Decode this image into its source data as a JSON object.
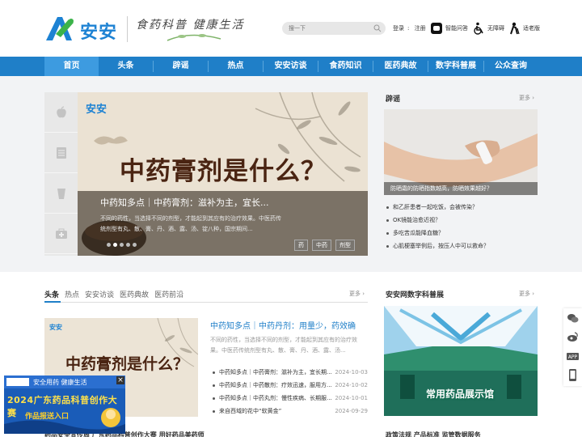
{
  "header": {
    "logo_text": "安安",
    "slogan": "食药科普 健康生活",
    "search_placeholder": "搜一下",
    "login": "登录",
    "register": "注册",
    "tools": [
      "智能问答",
      "无障碍",
      "适老版"
    ]
  },
  "nav": {
    "items": [
      "首页",
      "头条",
      "辟谣",
      "热点",
      "安安访谈",
      "食药知识",
      "医药典故",
      "数字科普展",
      "公众查询"
    ]
  },
  "banner": {
    "logo": "安安",
    "title": "中药膏剂是什么？",
    "heading": "中药知多点｜中药膏剂：滋补为主，宜长...",
    "desc": "不同的药性，当选择不同的剂型，才能起到其应有的治疗效果。中医药传统剂型有丸、散、膏、丹、酒、露、汤、锭八种，国宗期间...",
    "tags": [
      "药",
      "中药",
      "剂型"
    ]
  },
  "rumor": {
    "title": "辟谣",
    "more": "更多 ›",
    "caption": "防晒霜的防晒指数越高，防晒效果越好？",
    "items": [
      "和乙肝患者一起吃饭，会被传染？",
      "OK镜能治愈近视？",
      "多吃苦瓜能降血糖？",
      "心肌梗塞举例后，按压人中可以救命？"
    ]
  },
  "news": {
    "tabs": [
      "头条",
      "热点",
      "安安访谈",
      "医药典故",
      "医药前沿"
    ],
    "more": "更多 ›",
    "img_title": "中药膏剂是什么？",
    "head": "中药知多点｜中药丹剂：用量少，药效确",
    "summary": "不同的药性，当选择不同的剂型，才能起到其应有的治疗效果。中医药传统剂型有丸、散、膏、丹、酒、露、汤...",
    "items": [
      {
        "text": "中药知多点｜中药膏剂：滋补为主，宜长期...",
        "date": "2024-10-03"
      },
      {
        "text": "中药知多点｜中药散剂：疗效迅速，服用方...",
        "date": "2024-10-02"
      },
      {
        "text": "中药知多点｜中药丸剂：慢性疾病、长期服...",
        "date": "2024-10-01"
      },
      {
        "text": "来自西域的花中“软黄金”",
        "date": "2024-09-29"
      }
    ]
  },
  "expo": {
    "title": "安安网数字科普展",
    "more": "更多 ›",
    "label": "常用药品展示馆"
  },
  "bottom": {
    "left": "药品安全宣传周 广东药品科普创作大赛 用好药品美药师",
    "right": "政策法规 产品标准 监管数据服务"
  },
  "promo": {
    "line1": "安全用药 健康生活",
    "line2": "2024广东药品科普创作大赛",
    "line3": "作品报送入口"
  },
  "colors": {
    "primary": "#1f7fc8",
    "nav_active": "#3d9be0"
  }
}
